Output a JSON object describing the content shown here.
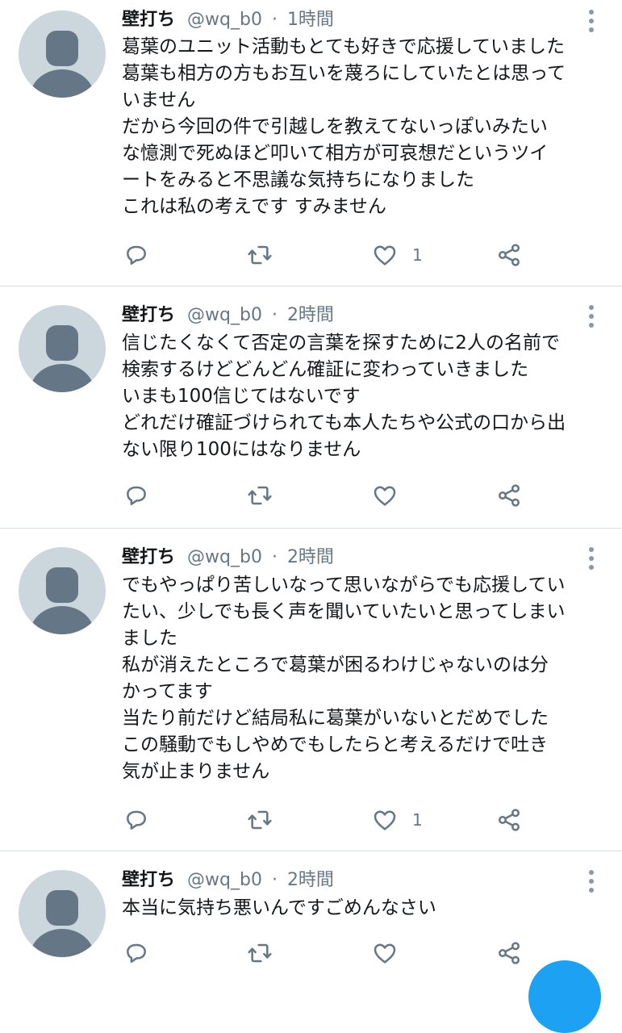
{
  "tweets": [
    {
      "name": "壁打ち",
      "handle": "@wq_b0",
      "separator": "·",
      "time": "1時間",
      "lines": [
        "葛葉のユニット活動もとても好きで応援していました",
        "葛葉も相方の方もお互いを蔑ろにしていたとは思って",
        "いません",
        "だから今回の件で引越しを教えてないっぽいみたい",
        "な憶測で死ぬほど叩いて相方が可哀想だというツイ",
        "ートをみると不思議な気持ちになりました",
        "これは私の考えです すみません"
      ],
      "like_count": "1"
    },
    {
      "name": "壁打ち",
      "handle": "@wq_b0",
      "separator": "·",
      "time": "2時間",
      "lines": [
        "信じたくなくて否定の言葉を探すために2人の名前で",
        "検索するけどどんどん確証に変わっていきました",
        "いまも100信じてはないです",
        "どれだけ確証づけられても本人たちや公式の口から出",
        "ない限り100にはなりません"
      ],
      "like_count": ""
    },
    {
      "name": "壁打ち",
      "handle": "@wq_b0",
      "separator": "·",
      "time": "2時間",
      "lines": [
        "でもやっぱり苦しいなって思いながらでも応援してい",
        "たい、少しでも長く声を聞いていたいと思ってしまい",
        "ました",
        "私が消えたところで葛葉が困るわけじゃないのは分",
        "かってます",
        "当たり前だけど結局私に葛葉がいないとだめでした",
        "この騒動でもしやめでもしたらと考えるだけで吐き",
        "気が止まりません"
      ],
      "like_count": "1"
    },
    {
      "name": "壁打ち",
      "handle": "@wq_b0",
      "separator": "·",
      "time": "2時間",
      "lines": [
        "本当に気持ち悪いんですごめんなさい"
      ],
      "like_count": ""
    }
  ],
  "colors": {
    "text": "#14171a",
    "secondary": "#657786",
    "icon": "#657786",
    "avatar_bg": "#ccd6dd",
    "divider": "#d9dee2",
    "accent": "#1da1f2"
  },
  "icons": [
    "reply-icon",
    "retweet-icon",
    "like-icon",
    "share-icon",
    "more-icon"
  ]
}
